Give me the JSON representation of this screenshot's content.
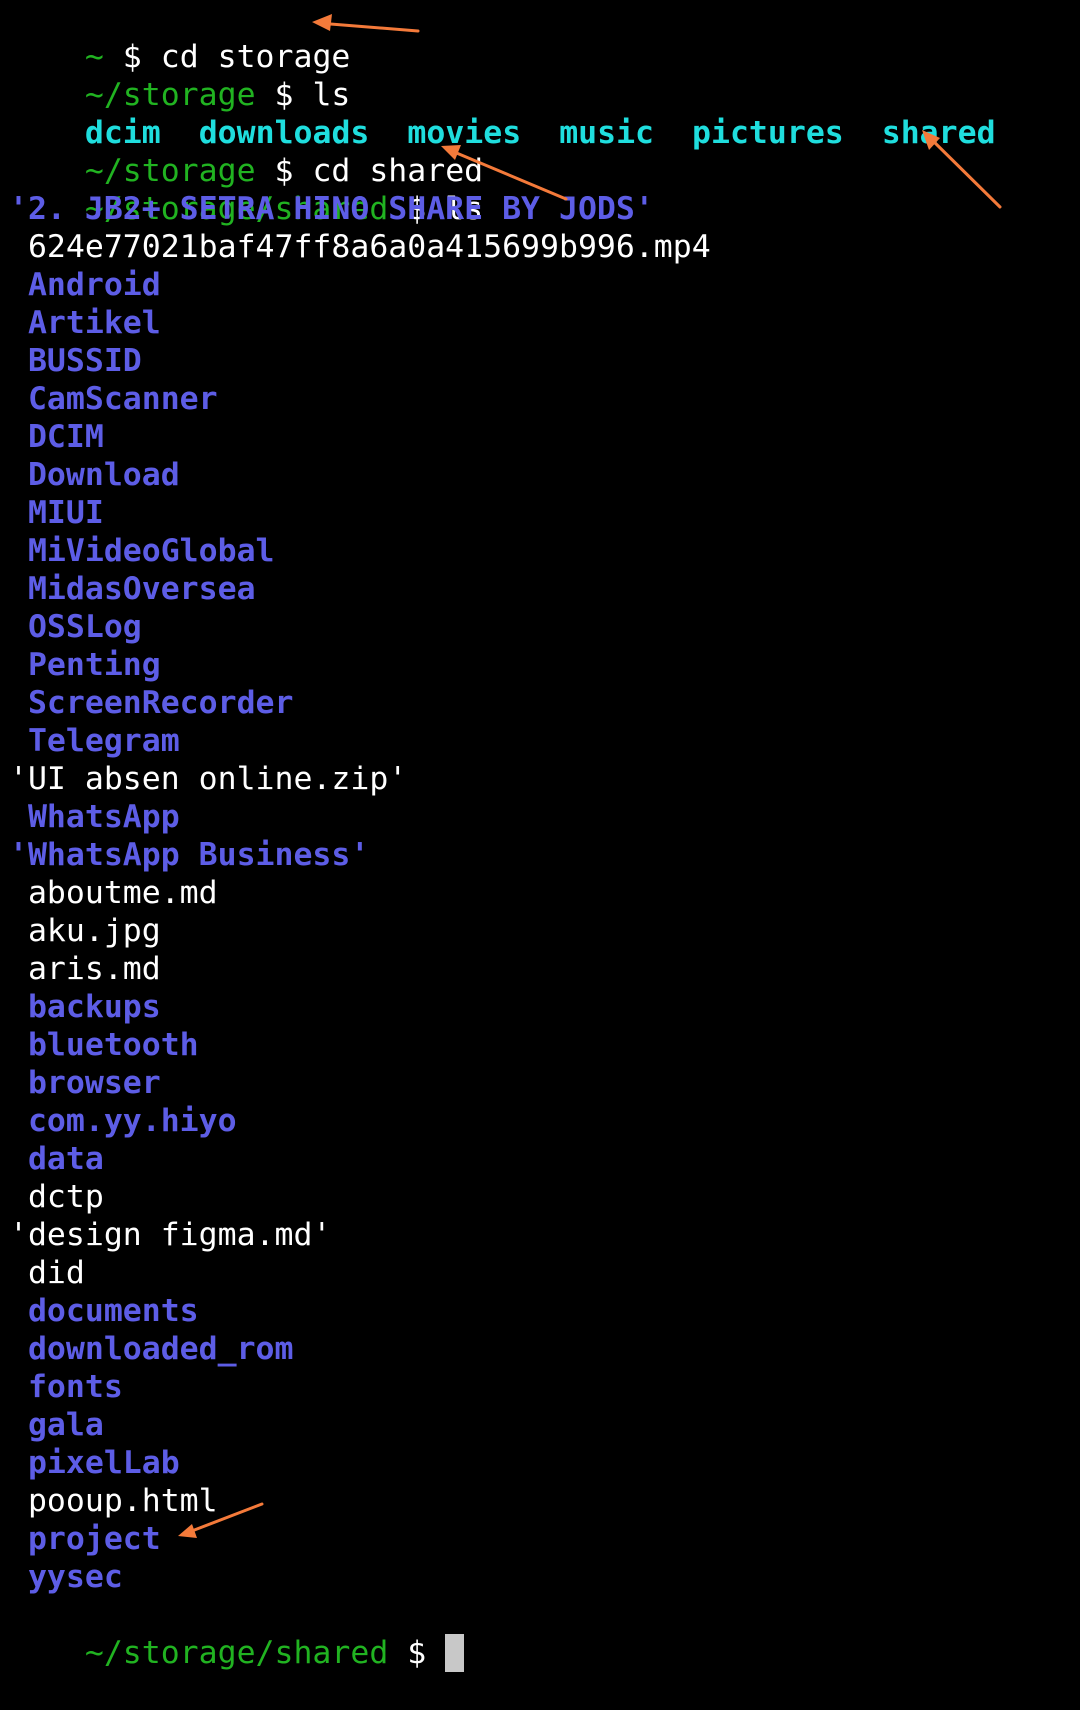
{
  "colors": {
    "background": "#000000",
    "prompt": "#21b321",
    "command": "#ffffff",
    "storage_dirs": "#1fdede",
    "directory": "#5d5de6",
    "file": "#ffffff",
    "annotation_arrow": "#f47a3a"
  },
  "session": [
    {
      "prompt": "~",
      "command": "cd storage"
    },
    {
      "prompt": "~/storage",
      "command": "ls"
    }
  ],
  "storage_listing": [
    "dcim",
    "downloads",
    "movies",
    "music",
    "pictures",
    "shared"
  ],
  "session2": [
    {
      "prompt": "~/storage",
      "command": "cd shared"
    },
    {
      "prompt": "~/storage/shared",
      "command": "ls"
    }
  ],
  "shared_listing": [
    {
      "name": "'2. JB2+ SETRA HINO SHARE BY JODS'",
      "type": "dir"
    },
    {
      "name": " 624e77021baf47ff8a6a0a415699b996.mp4",
      "type": "file"
    },
    {
      "name": " Android",
      "type": "dir"
    },
    {
      "name": " Artikel",
      "type": "dir"
    },
    {
      "name": " BUSSID",
      "type": "dir"
    },
    {
      "name": " CamScanner",
      "type": "dir"
    },
    {
      "name": " DCIM",
      "type": "dir"
    },
    {
      "name": " Download",
      "type": "dir"
    },
    {
      "name": " MIUI",
      "type": "dir"
    },
    {
      "name": " MiVideoGlobal",
      "type": "dir"
    },
    {
      "name": " MidasOversea",
      "type": "dir"
    },
    {
      "name": " OSSLog",
      "type": "dir"
    },
    {
      "name": " Penting",
      "type": "dir"
    },
    {
      "name": " ScreenRecorder",
      "type": "dir"
    },
    {
      "name": " Telegram",
      "type": "dir"
    },
    {
      "name": "'UI absen online.zip'",
      "type": "file"
    },
    {
      "name": " WhatsApp",
      "type": "dir"
    },
    {
      "name": "'WhatsApp Business'",
      "type": "dir"
    },
    {
      "name": " aboutme.md",
      "type": "file"
    },
    {
      "name": " aku.jpg",
      "type": "file"
    },
    {
      "name": " aris.md",
      "type": "file"
    },
    {
      "name": " backups",
      "type": "dir"
    },
    {
      "name": " bluetooth",
      "type": "dir"
    },
    {
      "name": " browser",
      "type": "dir"
    },
    {
      "name": " com.yy.hiyo",
      "type": "dir"
    },
    {
      "name": " data",
      "type": "dir"
    },
    {
      "name": " dctp",
      "type": "file"
    },
    {
      "name": "'design figma.md'",
      "type": "file"
    },
    {
      "name": " did",
      "type": "file"
    },
    {
      "name": " documents",
      "type": "dir"
    },
    {
      "name": " downloaded_rom",
      "type": "dir"
    },
    {
      "name": " fonts",
      "type": "dir"
    },
    {
      "name": " gala",
      "type": "dir"
    },
    {
      "name": " pixelLab",
      "type": "dir"
    },
    {
      "name": " pooup.html",
      "type": "file"
    },
    {
      "name": " project",
      "type": "dir"
    },
    {
      "name": " yysec",
      "type": "dir"
    }
  ],
  "final_prompt": {
    "prompt": "~/storage/shared",
    "dollar": "$"
  },
  "dollar": "$"
}
